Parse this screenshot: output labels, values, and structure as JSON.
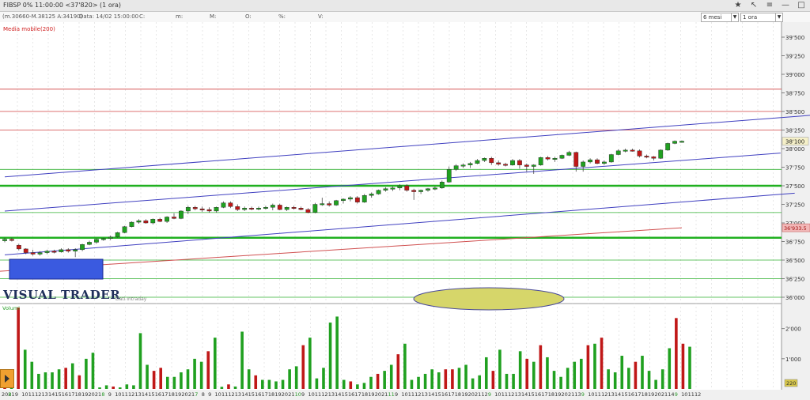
{
  "window": {
    "title": "FIBSP 0% 11:00:00  <37'820>  (1 ora)"
  },
  "infobar": {
    "fields": [
      "(m.30660-M.38125 A:34190)",
      "Data: 14/02 15:00:00",
      "C:",
      "m:",
      "M:",
      "O:",
      "%:",
      "V:"
    ],
    "period_select": "6 mesi",
    "interval_select": "1 ora"
  },
  "indicator": {
    "label": "Media mobile(200)"
  },
  "logo": {
    "text": "VISUAL TRADER"
  },
  "dati_label": "Dati Intraday",
  "volume_label": "Volumi",
  "price_axis": {
    "ticks": [
      "39'500",
      "39'250",
      "39'000",
      "38'750",
      "38'500",
      "38'250",
      "38'000",
      "37'750",
      "37'500",
      "37'250",
      "37'000",
      "36'750",
      "36'500",
      "36'250",
      "36'000"
    ],
    "current_label": "38'100",
    "ma_label": "36'933.5"
  },
  "volume_axis": {
    "ticks": [
      "2'000",
      "1'000"
    ],
    "current_label": "220"
  },
  "time_axis": {
    "labels": [
      "2021",
      "8",
      "9",
      "10",
      "11",
      "12",
      "13",
      "14",
      "15",
      "16",
      "17",
      "18",
      "19",
      "20",
      "21",
      "8",
      "9",
      "10",
      "11",
      "12",
      "13",
      "14",
      "15",
      "16",
      "17",
      "18",
      "19",
      "20",
      "21",
      "7",
      "8",
      "9",
      "10",
      "11",
      "12",
      "13",
      "14",
      "15",
      "16",
      "17",
      "18",
      "19",
      "20",
      "21",
      "10",
      "9",
      "10",
      "11",
      "12",
      "13",
      "14",
      "15",
      "16",
      "17",
      "18",
      "19",
      "20",
      "21",
      "11",
      "9",
      "10",
      "11",
      "12",
      "13",
      "14",
      "15",
      "16",
      "17",
      "18",
      "19",
      "20",
      "21",
      "12",
      "9",
      "10",
      "11",
      "12",
      "13",
      "14",
      "15",
      "16",
      "17",
      "18",
      "19",
      "20",
      "21",
      "13",
      "9",
      "10",
      "11",
      "12",
      "13",
      "14",
      "15",
      "16",
      "17",
      "18",
      "19",
      "20",
      "21",
      "14",
      "9",
      "10",
      "11",
      "12"
    ]
  },
  "chart_data": {
    "type": "candlestick",
    "price_ylim": [
      36000,
      39600
    ],
    "volume_ylim": [
      0,
      2700
    ],
    "horizontal_levels": {
      "red": [
        38800,
        38500,
        38250
      ],
      "green_thick": [
        37500,
        36800
      ],
      "green_thin": [
        37720,
        37140,
        36500,
        36250,
        36000
      ]
    },
    "moving_average": {
      "name": "Media mobile(200)",
      "start": 36350,
      "end": 36935
    },
    "trend_lines": [
      {
        "from": [
          0,
          37620
        ],
        "to": [
          120,
          38490
        ]
      },
      {
        "from": [
          0,
          37160
        ],
        "to": [
          110,
          37940
        ]
      },
      {
        "from": [
          0,
          36570
        ],
        "to": [
          112,
          37400
        ]
      }
    ],
    "ohlc": [
      [
        36760,
        36800,
        36740,
        36780
      ],
      [
        36780,
        36800,
        36750,
        36770
      ],
      [
        36700,
        36720,
        36630,
        36650
      ],
      [
        36650,
        36660,
        36580,
        36600
      ],
      [
        36600,
        36640,
        36560,
        36580
      ],
      [
        36580,
        36620,
        36560,
        36600
      ],
      [
        36600,
        36640,
        36580,
        36620
      ],
      [
        36620,
        36640,
        36590,
        36610
      ],
      [
        36610,
        36660,
        36600,
        36640
      ],
      [
        36640,
        36660,
        36600,
        36620
      ],
      [
        36620,
        36660,
        36540,
        36640
      ],
      [
        36640,
        36720,
        36620,
        36710
      ],
      [
        36710,
        36760,
        36700,
        36740
      ],
      [
        36740,
        36790,
        36720,
        36780
      ],
      [
        36780,
        36800,
        36760,
        36790
      ],
      [
        36790,
        36830,
        36770,
        36810
      ],
      [
        36810,
        36880,
        36800,
        36870
      ],
      [
        36870,
        36960,
        36860,
        36950
      ],
      [
        36950,
        37020,
        36940,
        37010
      ],
      [
        37010,
        37050,
        36990,
        37030
      ],
      [
        37030,
        37050,
        36990,
        37000
      ],
      [
        37000,
        37060,
        36980,
        37050
      ],
      [
        37050,
        37070,
        37010,
        37020
      ],
      [
        37020,
        37090,
        37000,
        37080
      ],
      [
        37080,
        37130,
        37050,
        37060
      ],
      [
        37060,
        37170,
        37050,
        37160
      ],
      [
        37160,
        37230,
        37120,
        37210
      ],
      [
        37210,
        37230,
        37170,
        37190
      ],
      [
        37190,
        37220,
        37150,
        37180
      ],
      [
        37180,
        37210,
        37140,
        37160
      ],
      [
        37160,
        37220,
        37140,
        37210
      ],
      [
        37210,
        37290,
        37200,
        37270
      ],
      [
        37270,
        37290,
        37200,
        37220
      ],
      [
        37220,
        37250,
        37160,
        37180
      ],
      [
        37180,
        37220,
        37160,
        37200
      ],
      [
        37200,
        37220,
        37170,
        37190
      ],
      [
        37190,
        37220,
        37170,
        37200
      ],
      [
        37200,
        37230,
        37180,
        37210
      ],
      [
        37210,
        37260,
        37170,
        37240
      ],
      [
        37240,
        37260,
        37170,
        37180
      ],
      [
        37180,
        37220,
        37160,
        37210
      ],
      [
        37210,
        37230,
        37180,
        37200
      ],
      [
        37200,
        37220,
        37170,
        37180
      ],
      [
        37180,
        37200,
        37130,
        37140
      ],
      [
        37140,
        37270,
        37130,
        37250
      ],
      [
        37250,
        37340,
        37230,
        37260
      ],
      [
        37260,
        37290,
        37220,
        37240
      ],
      [
        37240,
        37310,
        37230,
        37300
      ],
      [
        37300,
        37330,
        37260,
        37320
      ],
      [
        37320,
        37360,
        37290,
        37340
      ],
      [
        37340,
        37360,
        37260,
        37280
      ],
      [
        37280,
        37390,
        37270,
        37370
      ],
      [
        37370,
        37410,
        37340,
        37390
      ],
      [
        37390,
        37450,
        37380,
        37440
      ],
      [
        37440,
        37480,
        37420,
        37460
      ],
      [
        37460,
        37490,
        37430,
        37470
      ],
      [
        37470,
        37520,
        37440,
        37500
      ],
      [
        37500,
        37520,
        37420,
        37440
      ],
      [
        37440,
        37460,
        37310,
        37420
      ],
      [
        37420,
        37450,
        37390,
        37440
      ],
      [
        37440,
        37470,
        37420,
        37460
      ],
      [
        37460,
        37490,
        37440,
        37470
      ],
      [
        37470,
        37570,
        37460,
        37550
      ],
      [
        37550,
        37760,
        37540,
        37720
      ],
      [
        37720,
        37790,
        37700,
        37770
      ],
      [
        37770,
        37800,
        37740,
        37780
      ],
      [
        37780,
        37820,
        37740,
        37800
      ],
      [
        37800,
        37860,
        37790,
        37840
      ],
      [
        37840,
        37880,
        37820,
        37870
      ],
      [
        37870,
        37890,
        37780,
        37810
      ],
      [
        37810,
        37840,
        37770,
        37790
      ],
      [
        37790,
        37810,
        37760,
        37780
      ],
      [
        37780,
        37860,
        37770,
        37840
      ],
      [
        37840,
        37860,
        37730,
        37780
      ],
      [
        37780,
        37800,
        37690,
        37760
      ],
      [
        37760,
        37790,
        37660,
        37780
      ],
      [
        37780,
        37890,
        37770,
        37880
      ],
      [
        37880,
        37900,
        37840,
        37860
      ],
      [
        37860,
        37890,
        37820,
        37870
      ],
      [
        37870,
        37920,
        37860,
        37910
      ],
      [
        37910,
        37970,
        37900,
        37950
      ],
      [
        37950,
        37960,
        37690,
        37760
      ],
      [
        37760,
        37840,
        37690,
        37820
      ],
      [
        37820,
        37870,
        37800,
        37850
      ],
      [
        37850,
        37870,
        37790,
        37800
      ],
      [
        37800,
        37840,
        37780,
        37820
      ],
      [
        37820,
        37930,
        37810,
        37920
      ],
      [
        37920,
        37990,
        37910,
        37970
      ],
      [
        37970,
        38000,
        37950,
        37980
      ],
      [
        37980,
        38000,
        37960,
        37970
      ],
      [
        37970,
        37990,
        37880,
        37900
      ],
      [
        37900,
        37920,
        37870,
        37890
      ],
      [
        37890,
        37900,
        37840,
        37870
      ],
      [
        37870,
        37990,
        37860,
        37980
      ],
      [
        37980,
        38080,
        37970,
        38070
      ],
      [
        38070,
        38110,
        38060,
        38100
      ],
      [
        38100,
        38110,
        38080,
        38100
      ]
    ],
    "volumes": [
      120,
      180,
      2700,
      1300,
      900,
      500,
      550,
      550,
      650,
      700,
      850,
      450,
      1000,
      1200,
      50,
      120,
      80,
      50,
      150,
      120,
      1850,
      800,
      600,
      700,
      400,
      400,
      550,
      650,
      1000,
      900,
      1250,
      1700,
      70,
      150,
      80,
      1900,
      650,
      450,
      300,
      300,
      250,
      300,
      650,
      750,
      1450,
      1700,
      350,
      700,
      2200,
      2400,
      300,
      250,
      150,
      200,
      400,
      500,
      600,
      800,
      1150,
      1500,
      300,
      400,
      500,
      650,
      550,
      650,
      650,
      700,
      800,
      350,
      450,
      1050,
      600,
      1300,
      500,
      500,
      1250,
      1000,
      900,
      1450,
      1050,
      600,
      400,
      700,
      900,
      1000,
      1450,
      1500,
      1700,
      650,
      550,
      1100,
      700,
      900,
      1100,
      600,
      300,
      650,
      1350,
      2350,
      1500,
      1400
    ]
  }
}
